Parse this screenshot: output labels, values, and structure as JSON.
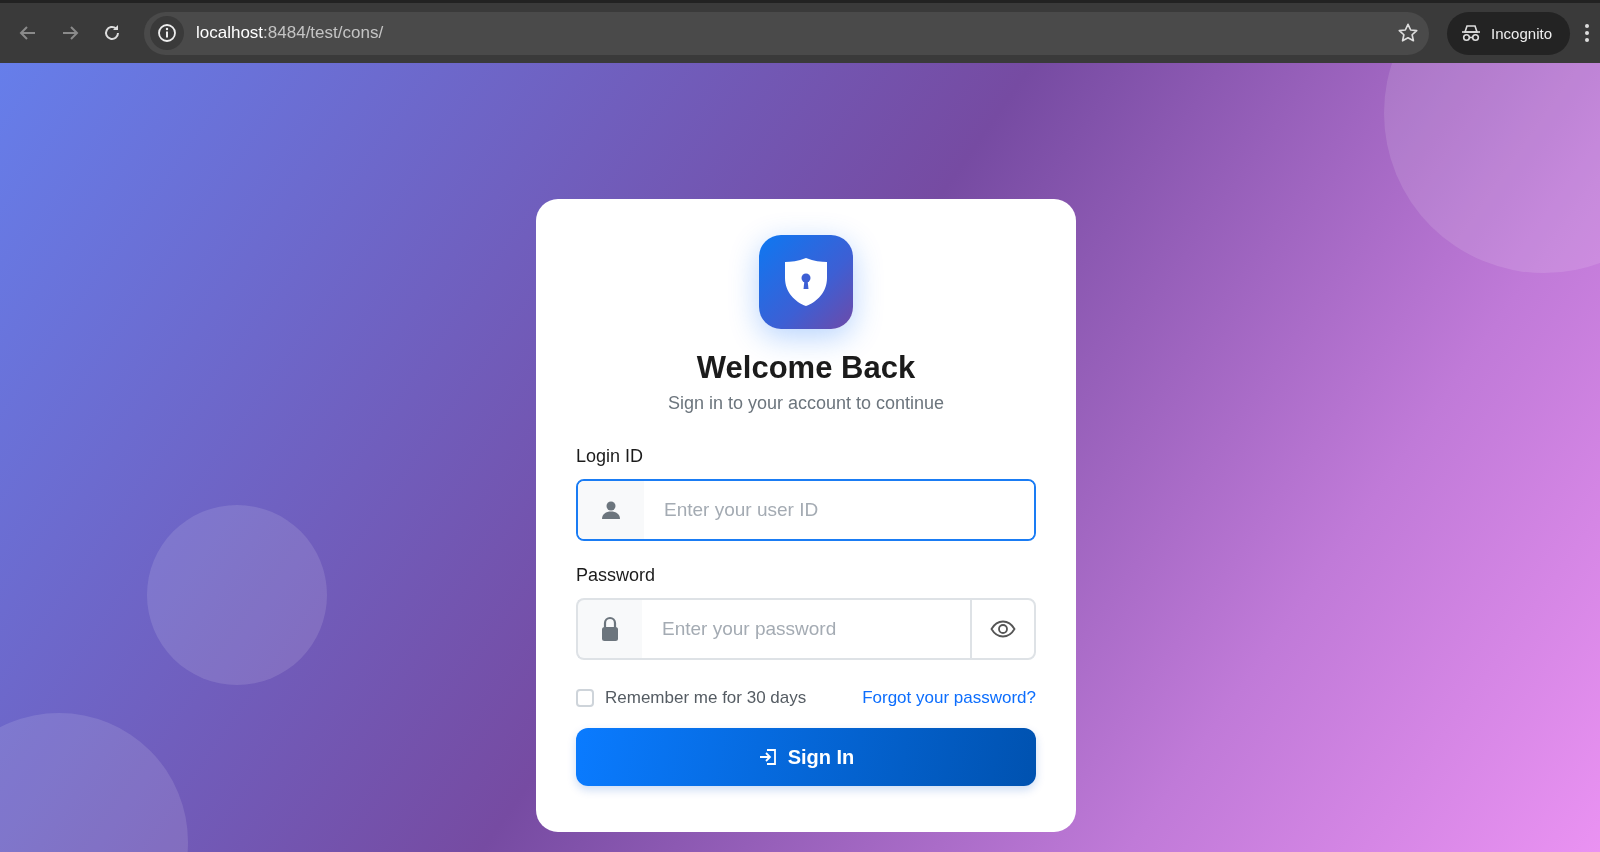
{
  "browser": {
    "url_host": "localhost",
    "url_path": ":8484/test/cons/",
    "profile": "Incognito"
  },
  "login": {
    "title": "Welcome Back",
    "subtitle": "Sign in to your account to continue",
    "fields": [
      {
        "kind": "user",
        "label": "Login ID",
        "placeholder": "Enter your user ID",
        "focused": true
      },
      {
        "kind": "password",
        "label": "Password",
        "placeholder": "Enter your password",
        "focused": false
      }
    ],
    "remember": {
      "label": "Remember me for 30 days",
      "checked": false
    },
    "forgot_link": "Forgot your password?",
    "submit": "Sign In"
  }
}
